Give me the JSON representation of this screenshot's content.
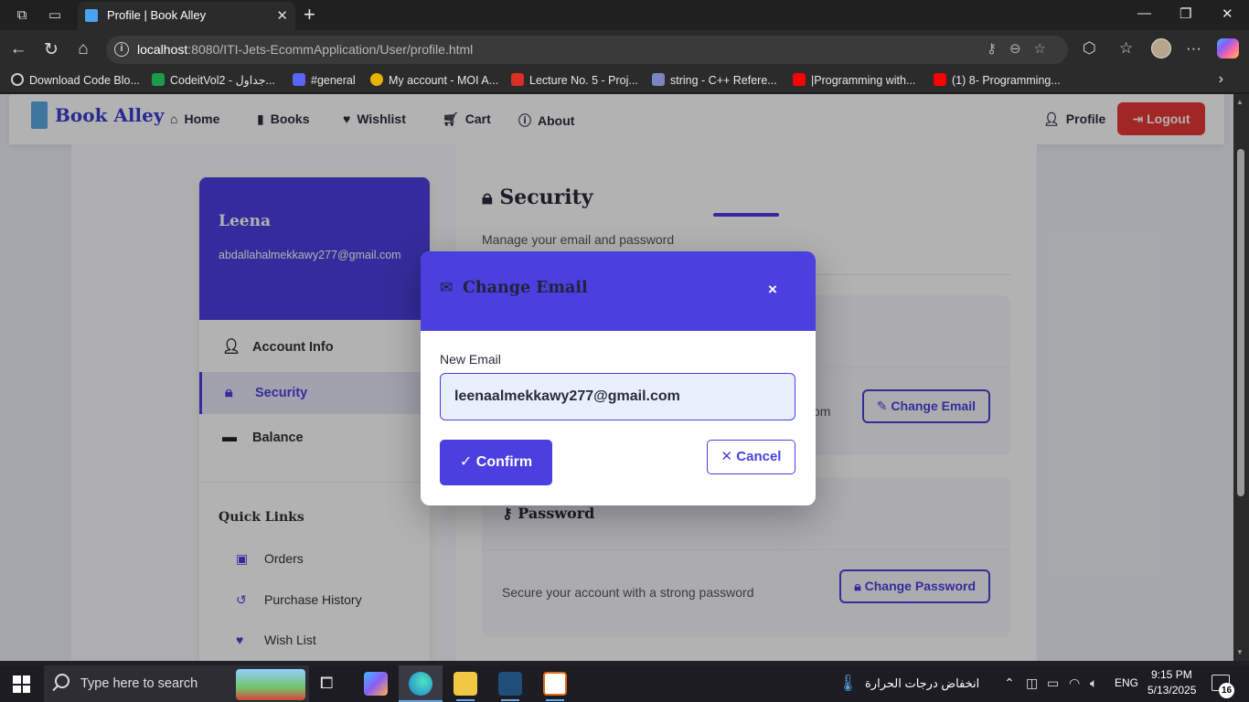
{
  "browser": {
    "tab_title": "Profile | Book Alley",
    "url_host": "localhost",
    "url_rest": ":8080/ITI-Jets-EcommApplication/User/profile.html",
    "bookmarks": [
      {
        "label": "Download Code Blo...",
        "color": "#222222"
      },
      {
        "label": "CodeitVol2 - جداول...",
        "color": "#1a9c4a"
      },
      {
        "label": "#general",
        "color": "#5865f2"
      },
      {
        "label": "My account - MOI A...",
        "color": "#e8b300"
      },
      {
        "label": "Lecture No. 5 - Proj...",
        "color": "#d93025"
      },
      {
        "label": "string - C++ Refere...",
        "color": "#7a86c2"
      },
      {
        "label": "|Programming with...",
        "color": "#ff0000"
      },
      {
        "label": "(1) 8- Programming...",
        "color": "#ff0000"
      }
    ]
  },
  "site": {
    "brand": "Book Alley",
    "nav": {
      "home": "Home",
      "books": "Books",
      "wishlist": "Wishlist",
      "cart": "Cart",
      "about": "About",
      "profile": "Profile",
      "logout": "Logout"
    }
  },
  "sidebar": {
    "name": "Leena",
    "email": "abdallahalmekkawy277@gmail.com",
    "items": [
      {
        "label": "Account Info",
        "icon": "user-icon"
      },
      {
        "label": "Security",
        "icon": "lock-icon"
      },
      {
        "label": "Balance",
        "icon": "wallet-icon"
      }
    ],
    "quick_links_title": "Quick Links",
    "quick_links": [
      {
        "label": "Orders",
        "icon": "box-icon"
      },
      {
        "label": "Purchase History",
        "icon": "history-icon"
      },
      {
        "label": "Wish List",
        "icon": "heart-icon"
      }
    ]
  },
  "security": {
    "title": "Security",
    "subtitle": "Manage your email and password",
    "email_text_tail": "om",
    "change_email": "Change Email",
    "password_title": "Password",
    "password_text": "Secure your account with a strong password",
    "change_password": "Change Password"
  },
  "modal": {
    "title": "Change Email",
    "close_glyph": "×",
    "field_label": "New Email",
    "email_value": "leenaalmekkawy277@gmail.com",
    "confirm": "Confirm",
    "cancel": "Cancel"
  },
  "taskbar": {
    "search_placeholder": "Type here to search",
    "weather_text": "انخفاض درجات الحرارة",
    "language": "ENG",
    "time": "9:15 PM",
    "date": "5/13/2025",
    "notifications": "16"
  },
  "colors": {
    "accent": "#4b3fe0",
    "danger": "#e53935"
  }
}
